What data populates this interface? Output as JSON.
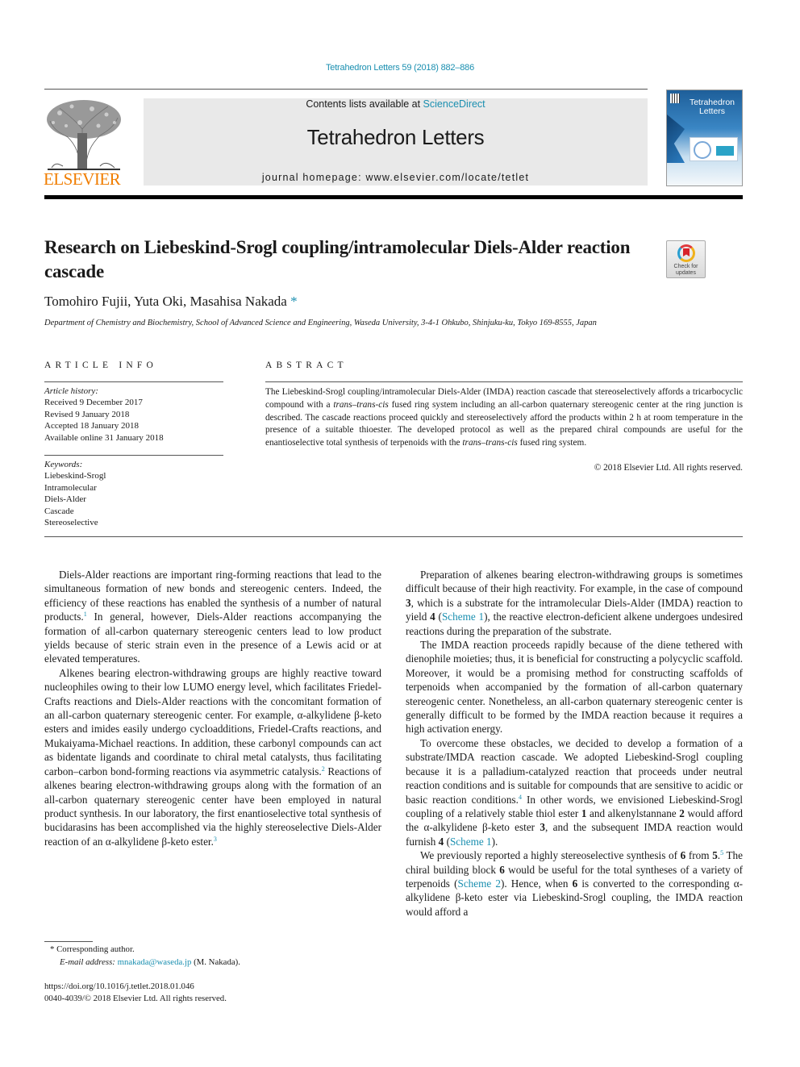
{
  "journal_ref": "Tetrahedron Letters 59 (2018) 882–886",
  "header": {
    "contents_prefix": "Contents lists available at ",
    "contents_link": "ScienceDirect",
    "journal_name": "Tetrahedron Letters",
    "homepage_prefix": "journal homepage: ",
    "homepage_url": "www.elsevier.com/locate/tetlet",
    "publisher_logo_text": "ELSEVIER",
    "cover_title_line1": "Tetrahedron",
    "cover_title_line2": "Letters",
    "check_updates_line1": "Check for",
    "check_updates_line2": "updates"
  },
  "article": {
    "title": "Research on Liebeskind-Srogl coupling/intramolecular Diels-Alder reaction cascade",
    "authors": "Tomohiro Fujii, Yuta Oki, Masahisa Nakada",
    "corresponding_marker": "*",
    "affiliation": "Department of Chemistry and Biochemistry, School of Advanced Science and Engineering, Waseda University, 3-4-1 Ohkubo, Shinjuku-ku, Tokyo 169-8555, Japan"
  },
  "article_info": {
    "heading": "ARTICLE INFO",
    "history_label": "Article history:",
    "history": [
      "Received 9 December 2017",
      "Revised 9 January 2018",
      "Accepted 18 January 2018",
      "Available online 31 January 2018"
    ],
    "keywords_label": "Keywords:",
    "keywords": [
      "Liebeskind-Srogl",
      "Intramolecular",
      "Diels-Alder",
      "Cascade",
      "Stereoselective"
    ]
  },
  "abstract": {
    "heading": "ABSTRACT",
    "part1": "The Liebeskind-Srogl coupling/intramolecular Diels-Alder (IMDA) reaction cascade that stereoselectively affords a tricarbocyclic compound with a ",
    "italic1": "trans–trans-cis",
    "part2": " fused ring system including an all-carbon quaternary stereogenic center at the ring junction is described. The cascade reactions proceed quickly and stereoselectively afford the products within 2 h at room temperature in the presence of a suitable thioester. The developed protocol as well as the prepared chiral compounds are useful for the enantioselective total synthesis of terpenoids with the ",
    "italic2": "trans–trans-cis",
    "part3": " fused ring system.",
    "copyright": "© 2018 Elsevier Ltd. All rights reserved."
  },
  "body": {
    "left": {
      "p1_a": "Diels-Alder reactions are important ring-forming reactions that lead to the simultaneous formation of new bonds and stereogenic centers. Indeed, the efficiency of these reactions has enabled the synthesis of a number of natural products.",
      "p1_ref": "1",
      "p1_b": " In general, however, Diels-Alder reactions accompanying the formation of all-carbon quaternary stereogenic centers lead to low product yields because of steric strain even in the presence of a Lewis acid or at elevated temperatures.",
      "p2_a": "Alkenes bearing electron-withdrawing groups are highly reactive toward nucleophiles owing to their low LUMO energy level, which facilitates Friedel-Crafts reactions and Diels-Alder reactions with the concomitant formation of an all-carbon quaternary stereogenic center. For example, α-alkylidene β-keto esters and imides easily undergo cycloadditions, Friedel-Crafts reactions, and Mukaiyama-Michael reactions. In addition, these carbonyl compounds can act as bidentate ligands and coordinate to chiral metal catalysts, thus facilitating carbon–carbon bond-forming reactions via asymmetric catalysis.",
      "p2_ref": "2",
      "p2_b": " Reactions of alkenes bearing electron-withdrawing groups along with the formation of an all-carbon quaternary stereogenic center have been employed in natural product synthesis. In our laboratory, the first enantioselective total synthesis of bucidarasins has been accomplished via the highly stereoselective Diels-Alder reaction of an α-alkylidene β-keto ester.",
      "p2_ref2": "3"
    },
    "right": {
      "p1_a": "Preparation of alkenes bearing electron-withdrawing groups is sometimes difficult because of their high reactivity. For example, in the case of compound ",
      "p1_c3": "3",
      "p1_b": ", which is a substrate for the intramolecular Diels-Alder (IMDA) reaction to yield ",
      "p1_c4": "4",
      "p1_link_open": " (",
      "p1_link": "Scheme 1",
      "p1_c": "), the reactive electron-deficient alkene undergoes undesired reactions during the preparation of the substrate.",
      "p2": "The IMDA reaction proceeds rapidly because of the diene tethered with dienophile moieties; thus, it is beneficial for constructing a polycyclic scaffold. Moreover, it would be a promising method for constructing scaffolds of terpenoids when accompanied by the formation of all-carbon quaternary stereogenic center. Nonetheless, an all-carbon quaternary stereogenic center is generally difficult to be formed by the IMDA reaction because it requires a high activation energy.",
      "p3_a": "To overcome these obstacles, we decided to develop a formation of a substrate/IMDA reaction cascade. We adopted Liebeskind-Srogl coupling because it is a palladium-catalyzed reaction that proceeds under neutral reaction conditions and is suitable for compounds that are sensitive to acidic or basic reaction conditions.",
      "p3_ref": "4",
      "p3_b": " In other words, we envisioned Liebeskind-Srogl coupling of a relatively stable thiol ester ",
      "p3_c1": "1",
      "p3_c": " and alkenylstannane ",
      "p3_c2": "2",
      "p3_d": " would afford the α-alkylidene β-keto ester ",
      "p3_c3": "3",
      "p3_e": ", and the subsequent IMDA reaction would furnish ",
      "p3_c4": "4",
      "p3_f": " (",
      "p3_link": "Scheme 1",
      "p3_g": ").",
      "p4_a": "We previously reported a highly stereoselective synthesis of ",
      "p4_c6": "6",
      "p4_b": " from ",
      "p4_c5": "5",
      "p4_dot": ".",
      "p4_ref": "5",
      "p4_c": " The chiral building block ",
      "p4_c6b": "6",
      "p4_d": " would be useful for the total syntheses of a variety of terpenoids (",
      "p4_link": "Scheme 2",
      "p4_e": "). Hence, when ",
      "p4_c6c": "6",
      "p4_f": " is converted to the corresponding α-alkylidene β-keto ester via Liebeskind-Srogl coupling, the IMDA reaction would afford a"
    }
  },
  "footer": {
    "corresponding_note": "* Corresponding author.",
    "email_label": "E-mail address: ",
    "email": "mnakada@waseda.jp",
    "email_suffix": " (M. Nakada).",
    "doi": "https://doi.org/10.1016/j.tetlet.2018.01.046",
    "issn": "0040-4039/© 2018 Elsevier Ltd. All rights reserved."
  }
}
